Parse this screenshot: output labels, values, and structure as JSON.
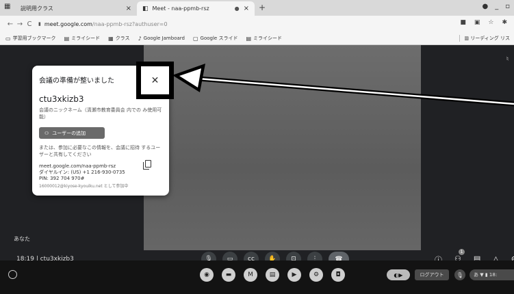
{
  "browser": {
    "tabs": [
      {
        "label": "説明用クラス",
        "icon": "calendar-icon"
      },
      {
        "label": "Meet - naa-ppmb-rsz",
        "icon": "meet-icon"
      }
    ],
    "url_host": "meet.google.com",
    "url_path": "/naa-ppmb-rsz?authuser=0",
    "bookmarks": [
      "学習用ブックマーク",
      "ミライシード",
      "クラス",
      "Google Jamboard",
      "Google スライド",
      "ミライシード"
    ],
    "reading_list": "リーディング リス"
  },
  "meet": {
    "panel": {
      "title": "会議の準備が整いました",
      "code": "ctu3xkizb3",
      "nickname": "会議のニックネーム（清瀬市教育委員会 内での み使用可能）",
      "add_user": "ユーザーの追加",
      "share_text": "または、参加に必要なこの情報を、会議に招待 するユーザーと共有してください",
      "link": "meet.google.com/naa-ppmb-rsz",
      "dial_in": "ダイヤルイン: (US) +1 216-930-0735",
      "pin": "PIN: 392 704 970#",
      "joined_as": "16000012@kiyose-kyouiku.net として参加中"
    },
    "you_label": "あなた",
    "time": "18:19",
    "separator": "|",
    "meeting_code": "ctu3xkizb3",
    "participant_count": "1"
  },
  "shelf": {
    "ime": "あ",
    "logout": "ログアウト",
    "tray_text": "あ ▼ ▮ 18:"
  },
  "colors": {
    "stage": "#202124",
    "annotation": "#000000"
  }
}
